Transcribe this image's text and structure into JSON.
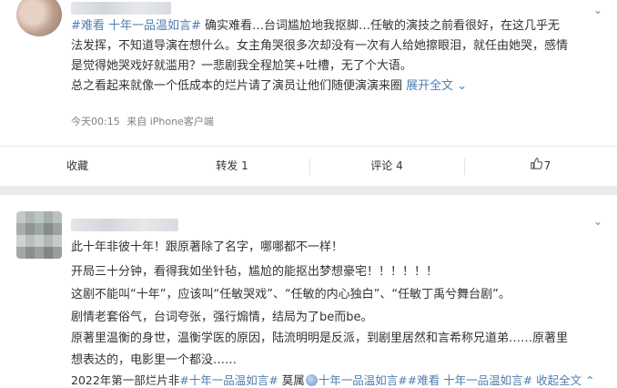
{
  "post1": {
    "topic_tag": "#难看 十年一品温如言#",
    "body_line1_rest": " 确实难看…台词尴尬地我抠脚…任敏的演技之前看很好，在这几乎无",
    "body_line2": "法发挥，不知道导演在想什么。女主角哭很多次却没有一次有人给她擦眼泪，就任由她哭，感情",
    "body_line3": "是觉得她哭戏好就滥用？一悲剧我全程尬笑+吐槽，无了个大语。",
    "body_line4": "总之看起来就像一个低成本的烂片请了演员让他们随便演演来圈",
    "expand_label": "展开全文",
    "expand_icon": "chevron-down-icon",
    "time": "今天00:15",
    "source": "来自 iPhone客户端",
    "actions": {
      "favorite": "收藏",
      "forward": "转发 1",
      "comment": "评论 4",
      "like_count": "7"
    }
  },
  "post2": {
    "lines": [
      "此十年非彼十年！跟原著除了名字，哪哪都不一样！",
      "开局三十分钟，看得我如坐针毡，尴尬的能抠出梦想豪宅！！！！！！",
      "这剧不能叫“十年”，应该叫“任敏哭戏”、“任敏的内心独白”、“任敏丁禹兮舞台剧”。",
      "剧情老套俗气，台词夸张，强行煽情，结局为了be而be。",
      "原著里温衡的身世，温衡学医的原因，陆流明明是反派，到剧里居然和言希称兄道弟……原著里",
      "想表达的，电影里一个都没……"
    ],
    "last_line_prefix": "2022年第一部烂片非",
    "last_line_tag1": "#十年一品温如言#",
    "last_line_mid": " 莫属",
    "last_line_tag2": "十年一品温如言#",
    "last_line_tag3": "#难看 十年一品温如言#",
    "collapse_label": "收起全文",
    "collapse_icon": "chevron-up-icon"
  }
}
